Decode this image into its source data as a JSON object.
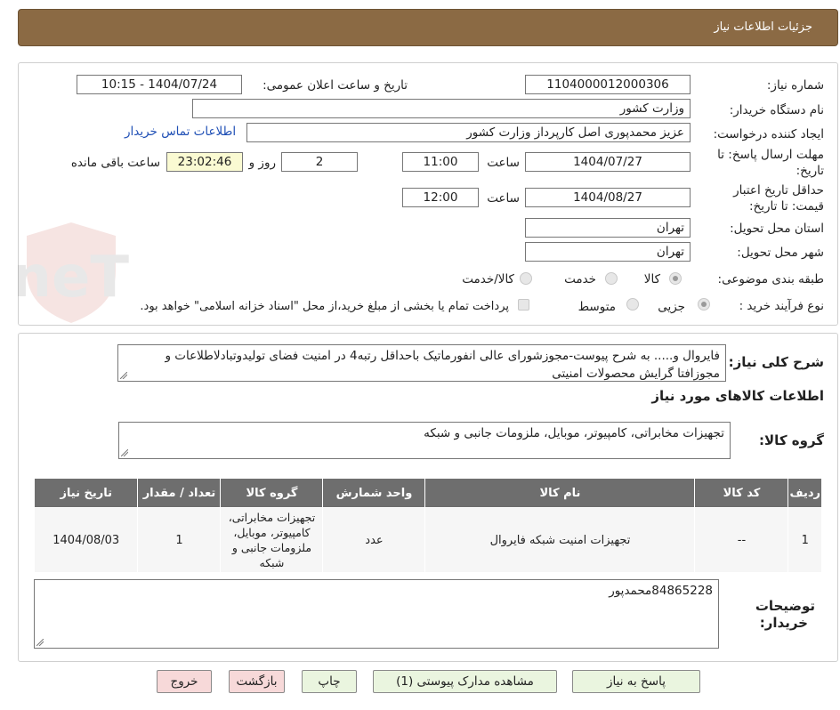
{
  "header": {
    "title": "جزئیات اطلاعات نیاز"
  },
  "watermark": "AriaTender.neT",
  "form": {
    "need_number_label": "شماره نیاز:",
    "need_number": "1104000012000306",
    "announce_label": "تاریخ و ساعت اعلان عمومی:",
    "announce_value": "1404/07/24 - 10:15",
    "buyer_org_label": "نام دستگاه خریدار:",
    "buyer_org": "وزارت کشور",
    "requester_label": "ایجاد کننده درخواست:",
    "requester": "عزیز محمدپوری اصل کارپرداز وزارت کشور",
    "contact_link": "اطلاعات تماس خریدار",
    "deadline_label_1": "مهلت ارسال پاسخ: تا",
    "deadline_label_2": "تاریخ:",
    "deadline_date": "1404/07/27",
    "time_label": "ساعت",
    "deadline_time": "11:00",
    "days_value": "2",
    "days_label": "روز و",
    "remaining_time": "23:02:46",
    "remaining_label": "ساعت باقی مانده",
    "validity_label_1": "حداقل تاریخ اعتبار",
    "validity_label_2": "قیمت: تا تاریخ:",
    "validity_date": "1404/08/27",
    "validity_time": "12:00",
    "province_label": "استان محل تحویل:",
    "province": "تهران",
    "city_label": "شهر محل تحویل:",
    "city": "تهران",
    "category_label": "طبقه بندی موضوعی:",
    "category_options": [
      "کالا",
      "خدمت",
      "کالا/خدمت"
    ],
    "category_selected": "کالا",
    "process_label": "نوع فرآیند خرید :",
    "process_options": [
      "جزیی",
      "متوسط"
    ],
    "process_selected": "جزیی",
    "payment_note": "پرداخت تمام یا بخشی از مبلغ خرید،از محل \"اسناد خزانه اسلامی\" خواهد بود."
  },
  "summary": {
    "label": "شرح کلی نیاز:",
    "text": "فایروال و..... به شرح پیوست-مجوزشورای عالی انفورماتیک باحداقل رتبه4 در امنیت فضای تولیدوتبادلاطلاعات و مجوزافتا گرایش محصولات امنیتی"
  },
  "goods_section": {
    "title": "اطلاعات کالاهای مورد نیاز"
  },
  "goods_group": {
    "label": "گروه کالا:",
    "value": "تجهیزات مخابراتی، کامپیوتر، موبایل، ملزومات جانبی و شبکه"
  },
  "table": {
    "headers": [
      "ردیف",
      "کد کالا",
      "نام کالا",
      "واحد شمارش",
      "گروه کالا",
      "تعداد / مقدار",
      "تاریخ نیاز"
    ],
    "rows": [
      [
        "1",
        "--",
        "تجهیزات امنیت شبکه فایروال",
        "عدد",
        "تجهیزات مخابراتی، کامپیوتر، موبایل، ملزومات جانبی و شبکه",
        "1",
        "1404/08/03"
      ]
    ]
  },
  "buyer_notes": {
    "label_1": "توضیحات",
    "label_2": "خریدار:",
    "text": "84865228محمدپور"
  },
  "buttons": {
    "reply": "پاسخ به نیاز",
    "attachments": "مشاهده مدارک پیوستی (1)",
    "print": "چاپ",
    "back": "بازگشت",
    "exit": "خروج"
  }
}
